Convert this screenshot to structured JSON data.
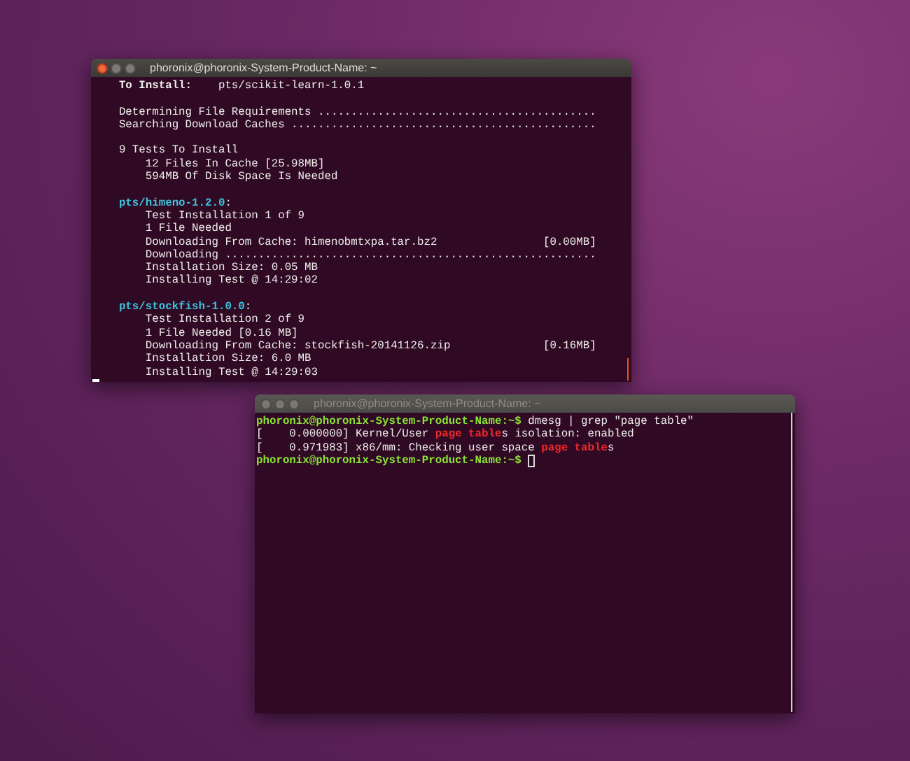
{
  "terminals": [
    {
      "title": "phoronix@phoronix-System-Product-Name: ~",
      "active": true,
      "kind": "installer",
      "lines": [
        {
          "segments": [
            {
              "text": "To Install:",
              "kind": "label"
            },
            {
              "text": "pts/scikit-learn-1.0.1",
              "kind": "plain"
            }
          ]
        },
        {
          "kind": "blank"
        },
        {
          "segments": [
            {
              "text": "Determining File Requirements ..........................................",
              "kind": "plain"
            }
          ]
        },
        {
          "segments": [
            {
              "text": "Searching Download Caches ..............................................",
              "kind": "plain"
            }
          ]
        },
        {
          "kind": "blank"
        },
        {
          "segments": [
            {
              "text": "9 Tests To Install",
              "kind": "plain"
            }
          ],
          "children": [
            {
              "segments": [
                {
                  "text": "12 Files In Cache [25.98MB]",
                  "kind": "plain"
                }
              ]
            },
            {
              "segments": [
                {
                  "text": "594MB Of Disk Space Is Needed",
                  "kind": "plain"
                }
              ]
            }
          ]
        },
        {
          "kind": "blank"
        },
        {
          "segments": [
            {
              "text": "pts/himeno-1.2.0",
              "kind": "path"
            },
            {
              "text": ":",
              "kind": "plain"
            }
          ],
          "children": [
            {
              "segments": [
                {
                  "text": "Test Installation 1 of 9",
                  "kind": "plain"
                }
              ]
            },
            {
              "segments": [
                {
                  "text": "1 File Needed",
                  "kind": "plain"
                }
              ]
            },
            {
              "segments": [
                {
                  "text": "Downloading From Cache: himenobmtxpa.tar.bz2",
                  "kind": "plain"
                }
              ],
              "right": "[0.00MB]"
            },
            {
              "segments": [
                {
                  "text": "Downloading ........................................................",
                  "kind": "plain"
                }
              ]
            },
            {
              "segments": [
                {
                  "text": "Installation Size: 0.05 MB",
                  "kind": "plain"
                }
              ]
            },
            {
              "segments": [
                {
                  "text": "Installing Test @ 14:29:02",
                  "kind": "plain"
                }
              ]
            }
          ]
        },
        {
          "kind": "blank"
        },
        {
          "segments": [
            {
              "text": "pts/stockfish-1.0.0",
              "kind": "path"
            },
            {
              "text": ":",
              "kind": "plain"
            }
          ],
          "children": [
            {
              "segments": [
                {
                  "text": "Test Installation 2 of 9",
                  "kind": "plain"
                }
              ]
            },
            {
              "segments": [
                {
                  "text": "1 File Needed [0.16 MB]",
                  "kind": "plain"
                }
              ]
            },
            {
              "segments": [
                {
                  "text": "Downloading From Cache: stockfish-20141126.zip",
                  "kind": "plain"
                }
              ],
              "right": "[0.16MB]"
            },
            {
              "segments": [
                {
                  "text": "Installation Size: 6.0 MB",
                  "kind": "plain"
                }
              ]
            },
            {
              "segments": [
                {
                  "text": "Installing Test @ 14:29:03",
                  "kind": "plain"
                }
              ]
            }
          ]
        },
        {
          "kind": "cursor"
        }
      ]
    },
    {
      "title": "phoronix@phoronix-System-Product-Name: ~",
      "active": false,
      "kind": "shell",
      "lines": [
        {
          "segments": [
            {
              "text": "phoronix@phoronix-System-Product-Name:~$",
              "kind": "prompt"
            },
            {
              "text": " dmesg | grep \"page table\"",
              "kind": "plain"
            }
          ]
        },
        {
          "segments": [
            {
              "text": "[    0.000000] Kernel/User ",
              "kind": "plain"
            },
            {
              "text": "page table",
              "kind": "match"
            },
            {
              "text": "s isolation: enabled",
              "kind": "plain"
            }
          ]
        },
        {
          "segments": [
            {
              "text": "[    0.971983] x86/mm: Checking user space ",
              "kind": "plain"
            },
            {
              "text": "page table",
              "kind": "match"
            },
            {
              "text": "s",
              "kind": "plain"
            }
          ]
        },
        {
          "segments": [
            {
              "text": "phoronix@phoronix-System-Product-Name:~$",
              "kind": "prompt"
            }
          ],
          "cursor": true
        }
      ]
    }
  ]
}
